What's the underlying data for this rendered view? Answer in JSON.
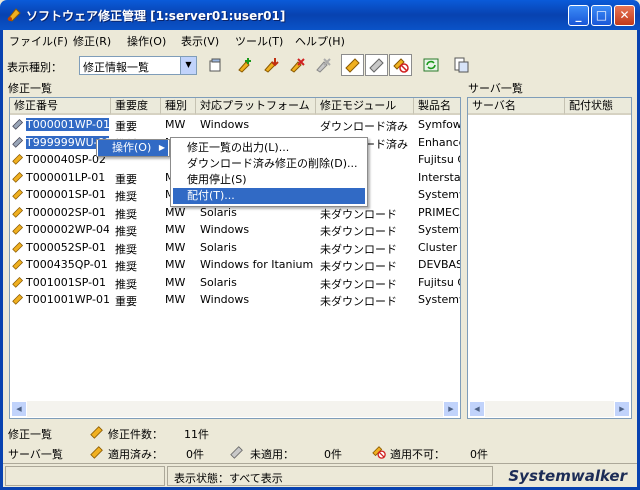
{
  "window": {
    "title": "ソフトウェア修正管理 [1:server01:user01]",
    "minimize": "_",
    "maximize": "□",
    "close": "✕"
  },
  "menubar": {
    "items": [
      "ファイル(F)",
      "修正(R)",
      "操作(O)",
      "表示(V)",
      "ツール(T)",
      "ヘルプ(H)"
    ]
  },
  "toolbar": {
    "display_type_label": "表示種別：",
    "display_type_value": "修正情報一覧"
  },
  "patch_list": {
    "section_label": "修正一覧",
    "columns": [
      "修正番号",
      "重要度",
      "種別",
      "対応プラットフォーム",
      "修正モジュール",
      "製品名"
    ],
    "rows": [
      {
        "id": "T000001WP-01",
        "severity": "重要",
        "type": "MW",
        "platform": "Windows",
        "module": "ダウンロード済み",
        "product": "Symfoware"
      },
      {
        "id": "T999999WU-01",
        "severity": "推奨",
        "type": "MW",
        "platform": "Windows",
        "module": "ダウンロード済み",
        "product": "Enhanced"
      },
      {
        "id": "T000040SP-02",
        "severity": "",
        "type": "",
        "platform": "",
        "module": "",
        "product": "Fujitsu C"
      },
      {
        "id": "T000001LP-01",
        "severity": "重要",
        "type": "M",
        "platform": "",
        "module": "",
        "product": "Interstage"
      },
      {
        "id": "T000001SP-01",
        "severity": "推奨",
        "type": "M",
        "platform": "",
        "module": "ロード",
        "product": "Systemwa"
      },
      {
        "id": "T000002SP-01",
        "severity": "推奨",
        "type": "MW",
        "platform": "Solaris",
        "module": "未ダウンロード",
        "product": "PRIMECL"
      },
      {
        "id": "T000002WP-04",
        "severity": "推奨",
        "type": "MW",
        "platform": "Windows",
        "module": "未ダウンロード",
        "product": "Systemwa"
      },
      {
        "id": "T000052SP-01",
        "severity": "推奨",
        "type": "MW",
        "platform": "Solaris",
        "module": "未ダウンロード",
        "product": "Cluster S"
      },
      {
        "id": "T000435QP-01",
        "severity": "推奨",
        "type": "MW",
        "platform": "Windows for Itanium",
        "module": "未ダウンロード",
        "product": "DEVBASI"
      },
      {
        "id": "T001001SP-01",
        "severity": "推奨",
        "type": "MW",
        "platform": "Solaris",
        "module": "未ダウンロード",
        "product": "Fujitsu C"
      },
      {
        "id": "T001001WP-01",
        "severity": "重要",
        "type": "MW",
        "platform": "Windows",
        "module": "未ダウンロード",
        "product": "Systemwa"
      }
    ]
  },
  "server_list": {
    "section_label": "サーバ一覧",
    "columns": [
      "サーバ名",
      "配付状態"
    ]
  },
  "context_menu": {
    "parent_label": "操作(O)",
    "parent_arrow": "▶",
    "items": [
      "修正一覧の出力(L)...",
      "ダウンロード済み修正の削除(D)...",
      "使用停止(S)",
      "配付(T)..."
    ],
    "highlighted_index": 3
  },
  "summary": {
    "patch_list_label": "修正一覧",
    "patch_count_label": "修正件数：",
    "patch_count_value": "11件",
    "server_list_label": "サーバ一覧",
    "applied_label": "適用済み：",
    "applied_value": "0件",
    "unapplied_label": "未適用：",
    "unapplied_value": "0件",
    "not_applicable_label": "適用不可：",
    "not_applicable_value": "0件"
  },
  "statusbar": {
    "display_state": "表示状態：すべて表示",
    "brand": "Systemwalker"
  },
  "colors": {
    "selection": "#316ac5",
    "titlebar": "#0842b0"
  }
}
